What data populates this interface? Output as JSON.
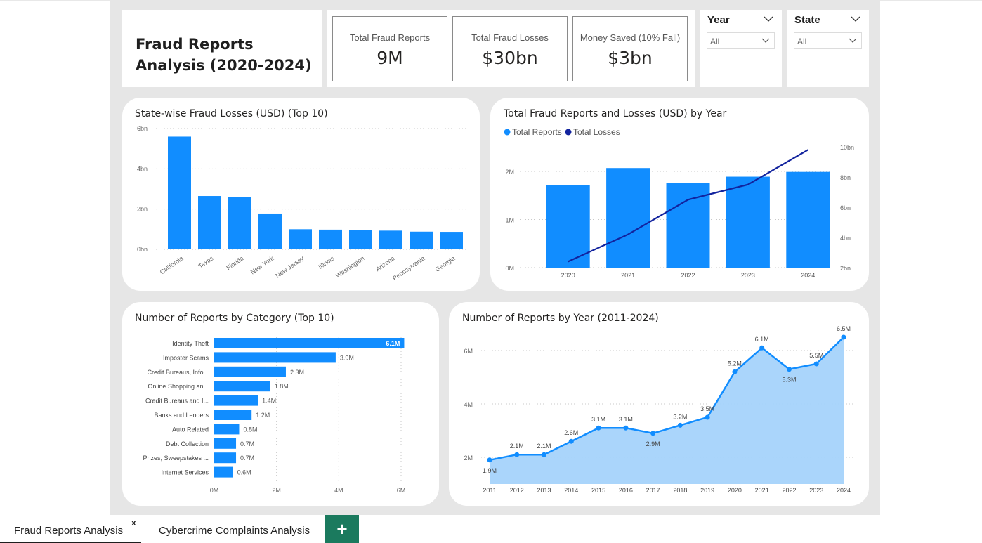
{
  "report": {
    "title_line1": "Fraud Reports",
    "title_line2": "Analysis (2020-2024)"
  },
  "kpis": [
    {
      "label": "Total Fraud Reports",
      "value": "9M"
    },
    {
      "label": "Total Fraud Losses",
      "value": "$30bn"
    },
    {
      "label": "Money Saved (10% Fall)",
      "value": "$3bn"
    }
  ],
  "slicers": {
    "year": {
      "header": "Year",
      "value": "All"
    },
    "state": {
      "header": "State",
      "value": "All"
    }
  },
  "colors": {
    "primary": "#118dff",
    "dark": "#12239e",
    "area": "#a5d3fb"
  },
  "tabs": {
    "active": "Fraud Reports Analysis",
    "close": "x",
    "second": "Cybercrime Complaints Analysis",
    "add": "+"
  },
  "chart_data": [
    {
      "type": "bar",
      "title": "State-wise Fraud Losses (USD) (Top 10)",
      "categories": [
        "California",
        "Texas",
        "Florida",
        "New York",
        "New Jersey",
        "Illinois",
        "Washington",
        "Arizona",
        "Pennsylvania",
        "Georgia"
      ],
      "values": [
        5.6,
        2.65,
        2.6,
        1.78,
        1.0,
        0.98,
        0.96,
        0.93,
        0.88,
        0.87
      ],
      "yticks": [
        "0bn",
        "2bn",
        "4bn",
        "6bn"
      ],
      "ylim": [
        0,
        6
      ],
      "grid": true
    },
    {
      "type": "bar+line",
      "title": "Total Fraud Reports and Losses (USD) by Year",
      "categories": [
        "2020",
        "2021",
        "2022",
        "2023",
        "2024"
      ],
      "series": [
        {
          "name": "Total Reports",
          "type": "bar",
          "axis": "left",
          "values": [
            1.72,
            2.07,
            1.76,
            1.89,
            1.99
          ]
        },
        {
          "name": "Total Losses",
          "type": "line",
          "axis": "right",
          "values": [
            2.4,
            4.2,
            6.5,
            7.5,
            9.8
          ]
        }
      ],
      "yticks_left": [
        "0M",
        "1M",
        "2M"
      ],
      "ylim_left": [
        0,
        2.0
      ],
      "yticks_right": [
        "2bn",
        "4bn",
        "6bn",
        "8bn",
        "10bn"
      ],
      "ylim_right": [
        2,
        10
      ],
      "legend": "top-left"
    },
    {
      "type": "bar",
      "orientation": "horizontal",
      "title": "Number of Reports by Category (Top 10)",
      "categories": [
        "Identity Theft",
        "Imposter Scams",
        "Credit Bureaus, Info...",
        "Online Shopping an...",
        "Credit Bureaus and I...",
        "Banks and Lenders",
        "Auto Related",
        "Debt Collection",
        "Prizes, Sweepstakes ...",
        "Internet Services"
      ],
      "values": [
        6.1,
        3.9,
        2.3,
        1.8,
        1.4,
        1.2,
        0.8,
        0.7,
        0.7,
        0.6
      ],
      "labels": [
        "6.1M",
        "3.9M",
        "2.3M",
        "1.8M",
        "1.4M",
        "1.2M",
        "0.8M",
        "0.7M",
        "0.7M",
        "0.6M"
      ],
      "xticks": [
        "0M",
        "2M",
        "4M",
        "6M"
      ],
      "xlim": [
        0,
        6
      ]
    },
    {
      "type": "area",
      "title": "Number of Reports by Year (2011-2024)",
      "x": [
        "2011",
        "2012",
        "2013",
        "2014",
        "2015",
        "2016",
        "2017",
        "2018",
        "2019",
        "2020",
        "2021",
        "2022",
        "2023",
        "2024"
      ],
      "values": [
        1.9,
        2.1,
        2.1,
        2.6,
        3.1,
        3.1,
        2.9,
        3.2,
        3.5,
        5.2,
        6.1,
        5.3,
        5.5,
        6.5
      ],
      "labels": [
        "1.9M",
        "2.1M",
        "2.1M",
        "2.6M",
        "3.1M",
        "3.1M",
        "2.9M",
        "3.2M",
        "3.5M",
        "5.2M",
        "6.1M",
        "5.3M",
        "5.5M",
        "6.5M"
      ],
      "yticks": [
        "2M",
        "4M",
        "6M"
      ],
      "ylim": [
        1.0,
        7.0
      ]
    }
  ]
}
